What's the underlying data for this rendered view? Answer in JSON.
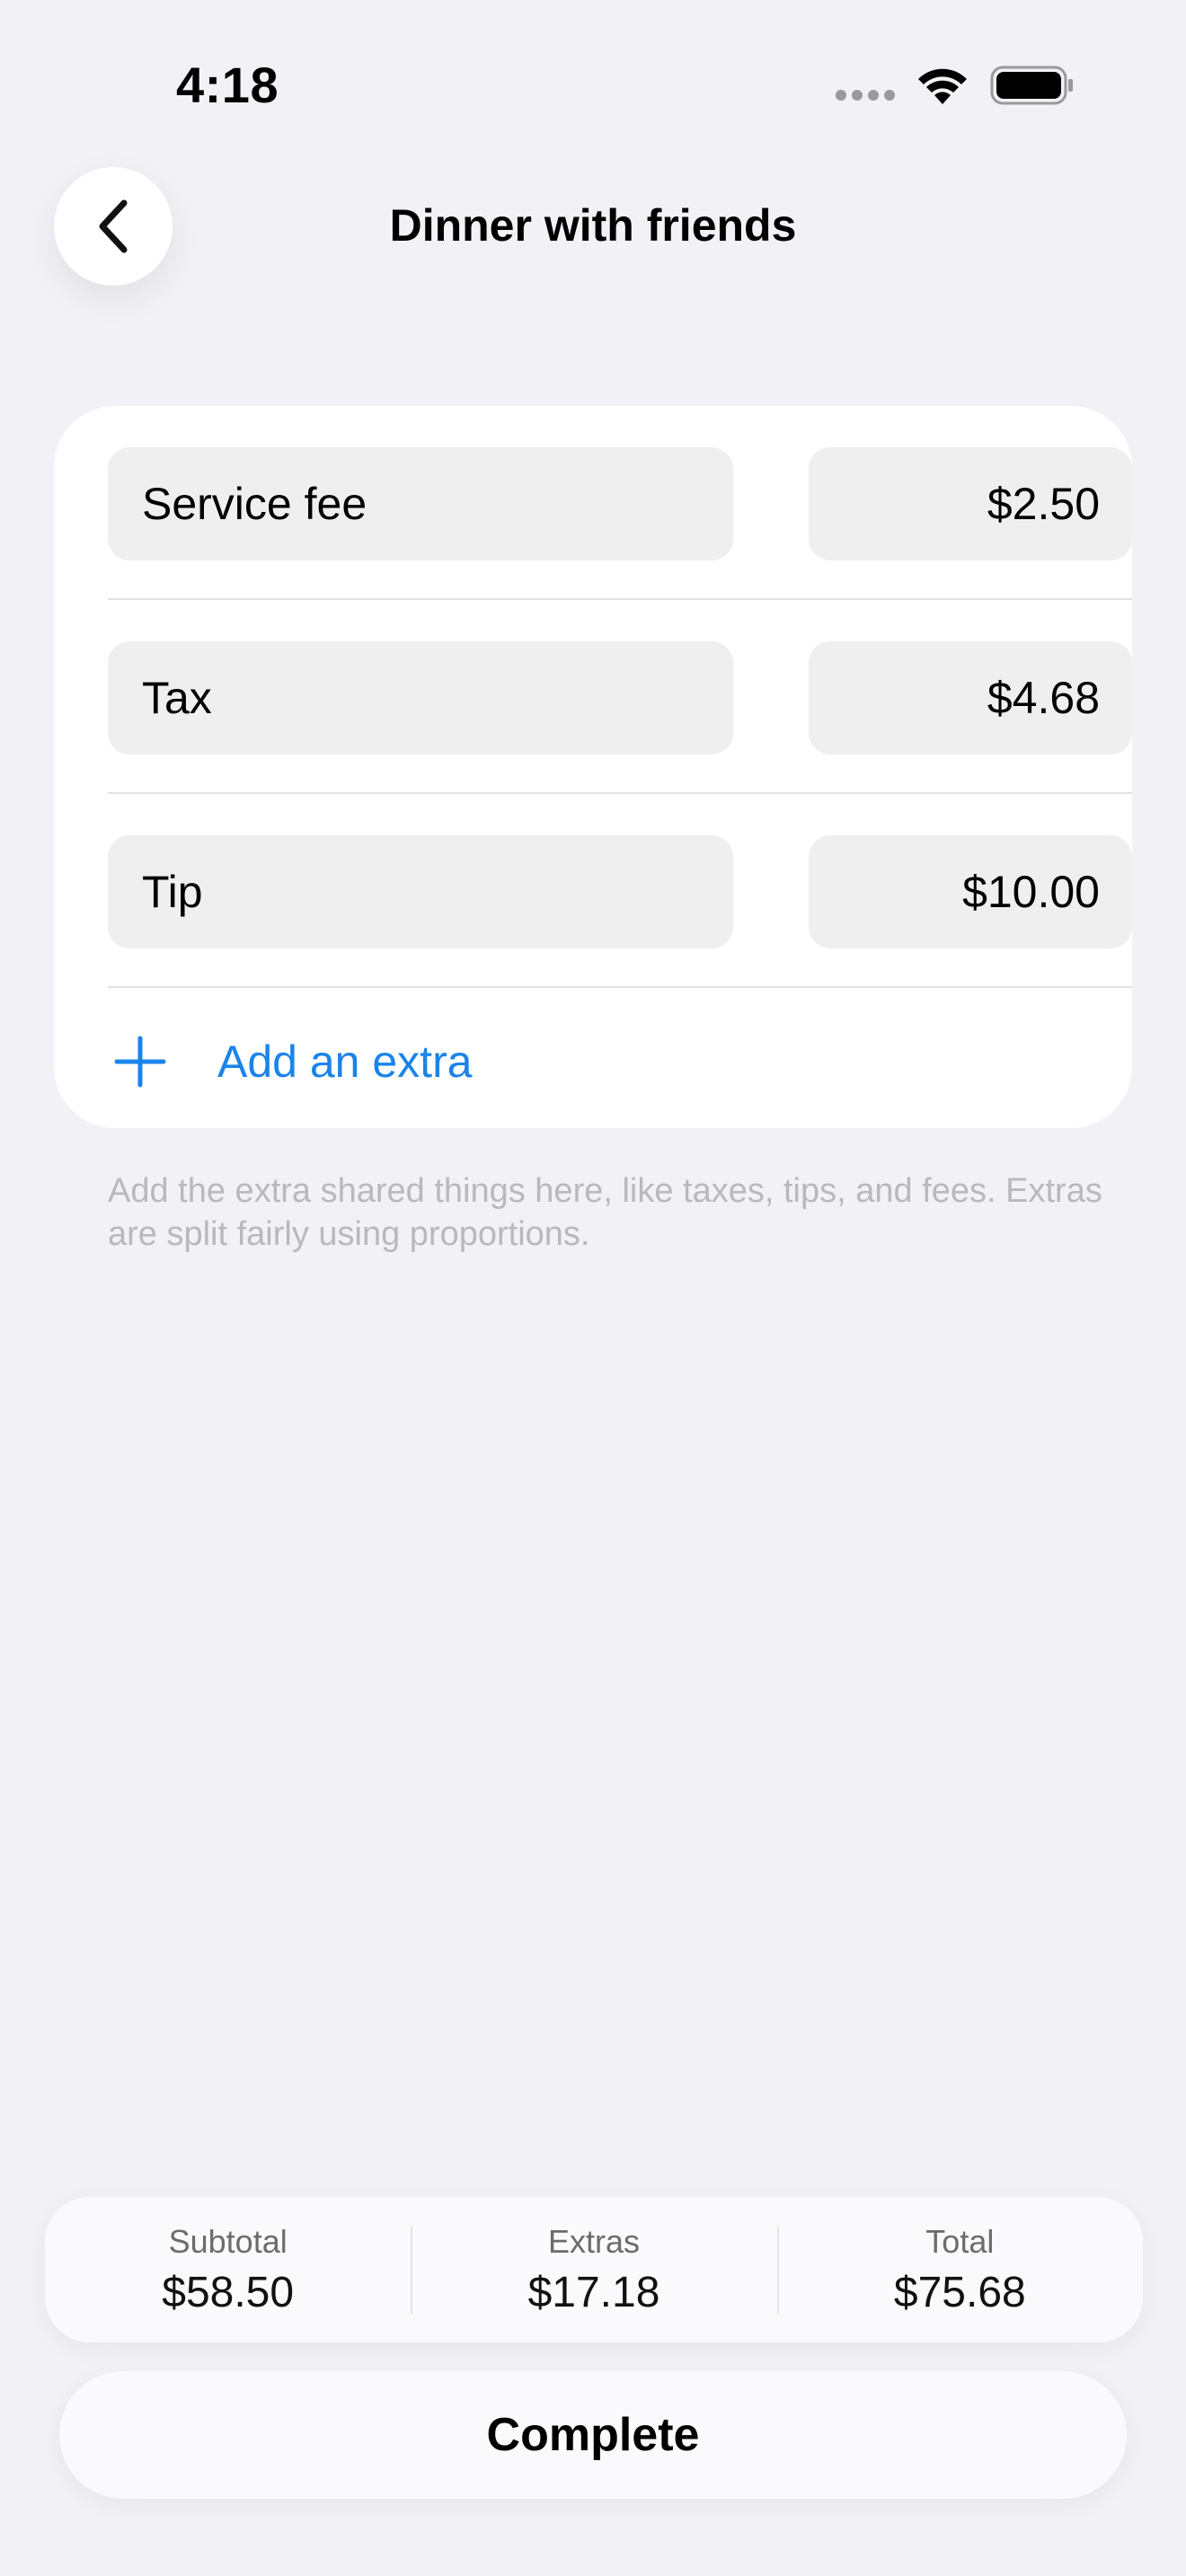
{
  "status_bar": {
    "time": "4:18"
  },
  "nav": {
    "title": "Dinner with friends",
    "back_icon": "chevron-left-icon"
  },
  "extras": [
    {
      "name": "Service fee",
      "amount": "$2.50"
    },
    {
      "name": "Tax",
      "amount": "$4.68"
    },
    {
      "name": "Tip",
      "amount": "$10.00"
    }
  ],
  "add_extra": {
    "label": "Add an extra",
    "icon": "plus-icon"
  },
  "footnote": "Add the extra shared things here, like taxes, tips, and fees. Extras are split fairly using proportions.",
  "summary": {
    "subtotal_label": "Subtotal",
    "subtotal_value": "$58.50",
    "extras_label": "Extras",
    "extras_value": "$17.18",
    "total_label": "Total",
    "total_value": "$75.68"
  },
  "complete_label": "Complete",
  "colors": {
    "background": "#f2f2f6",
    "accent": "#1a84ea",
    "field": "#efeff0"
  }
}
